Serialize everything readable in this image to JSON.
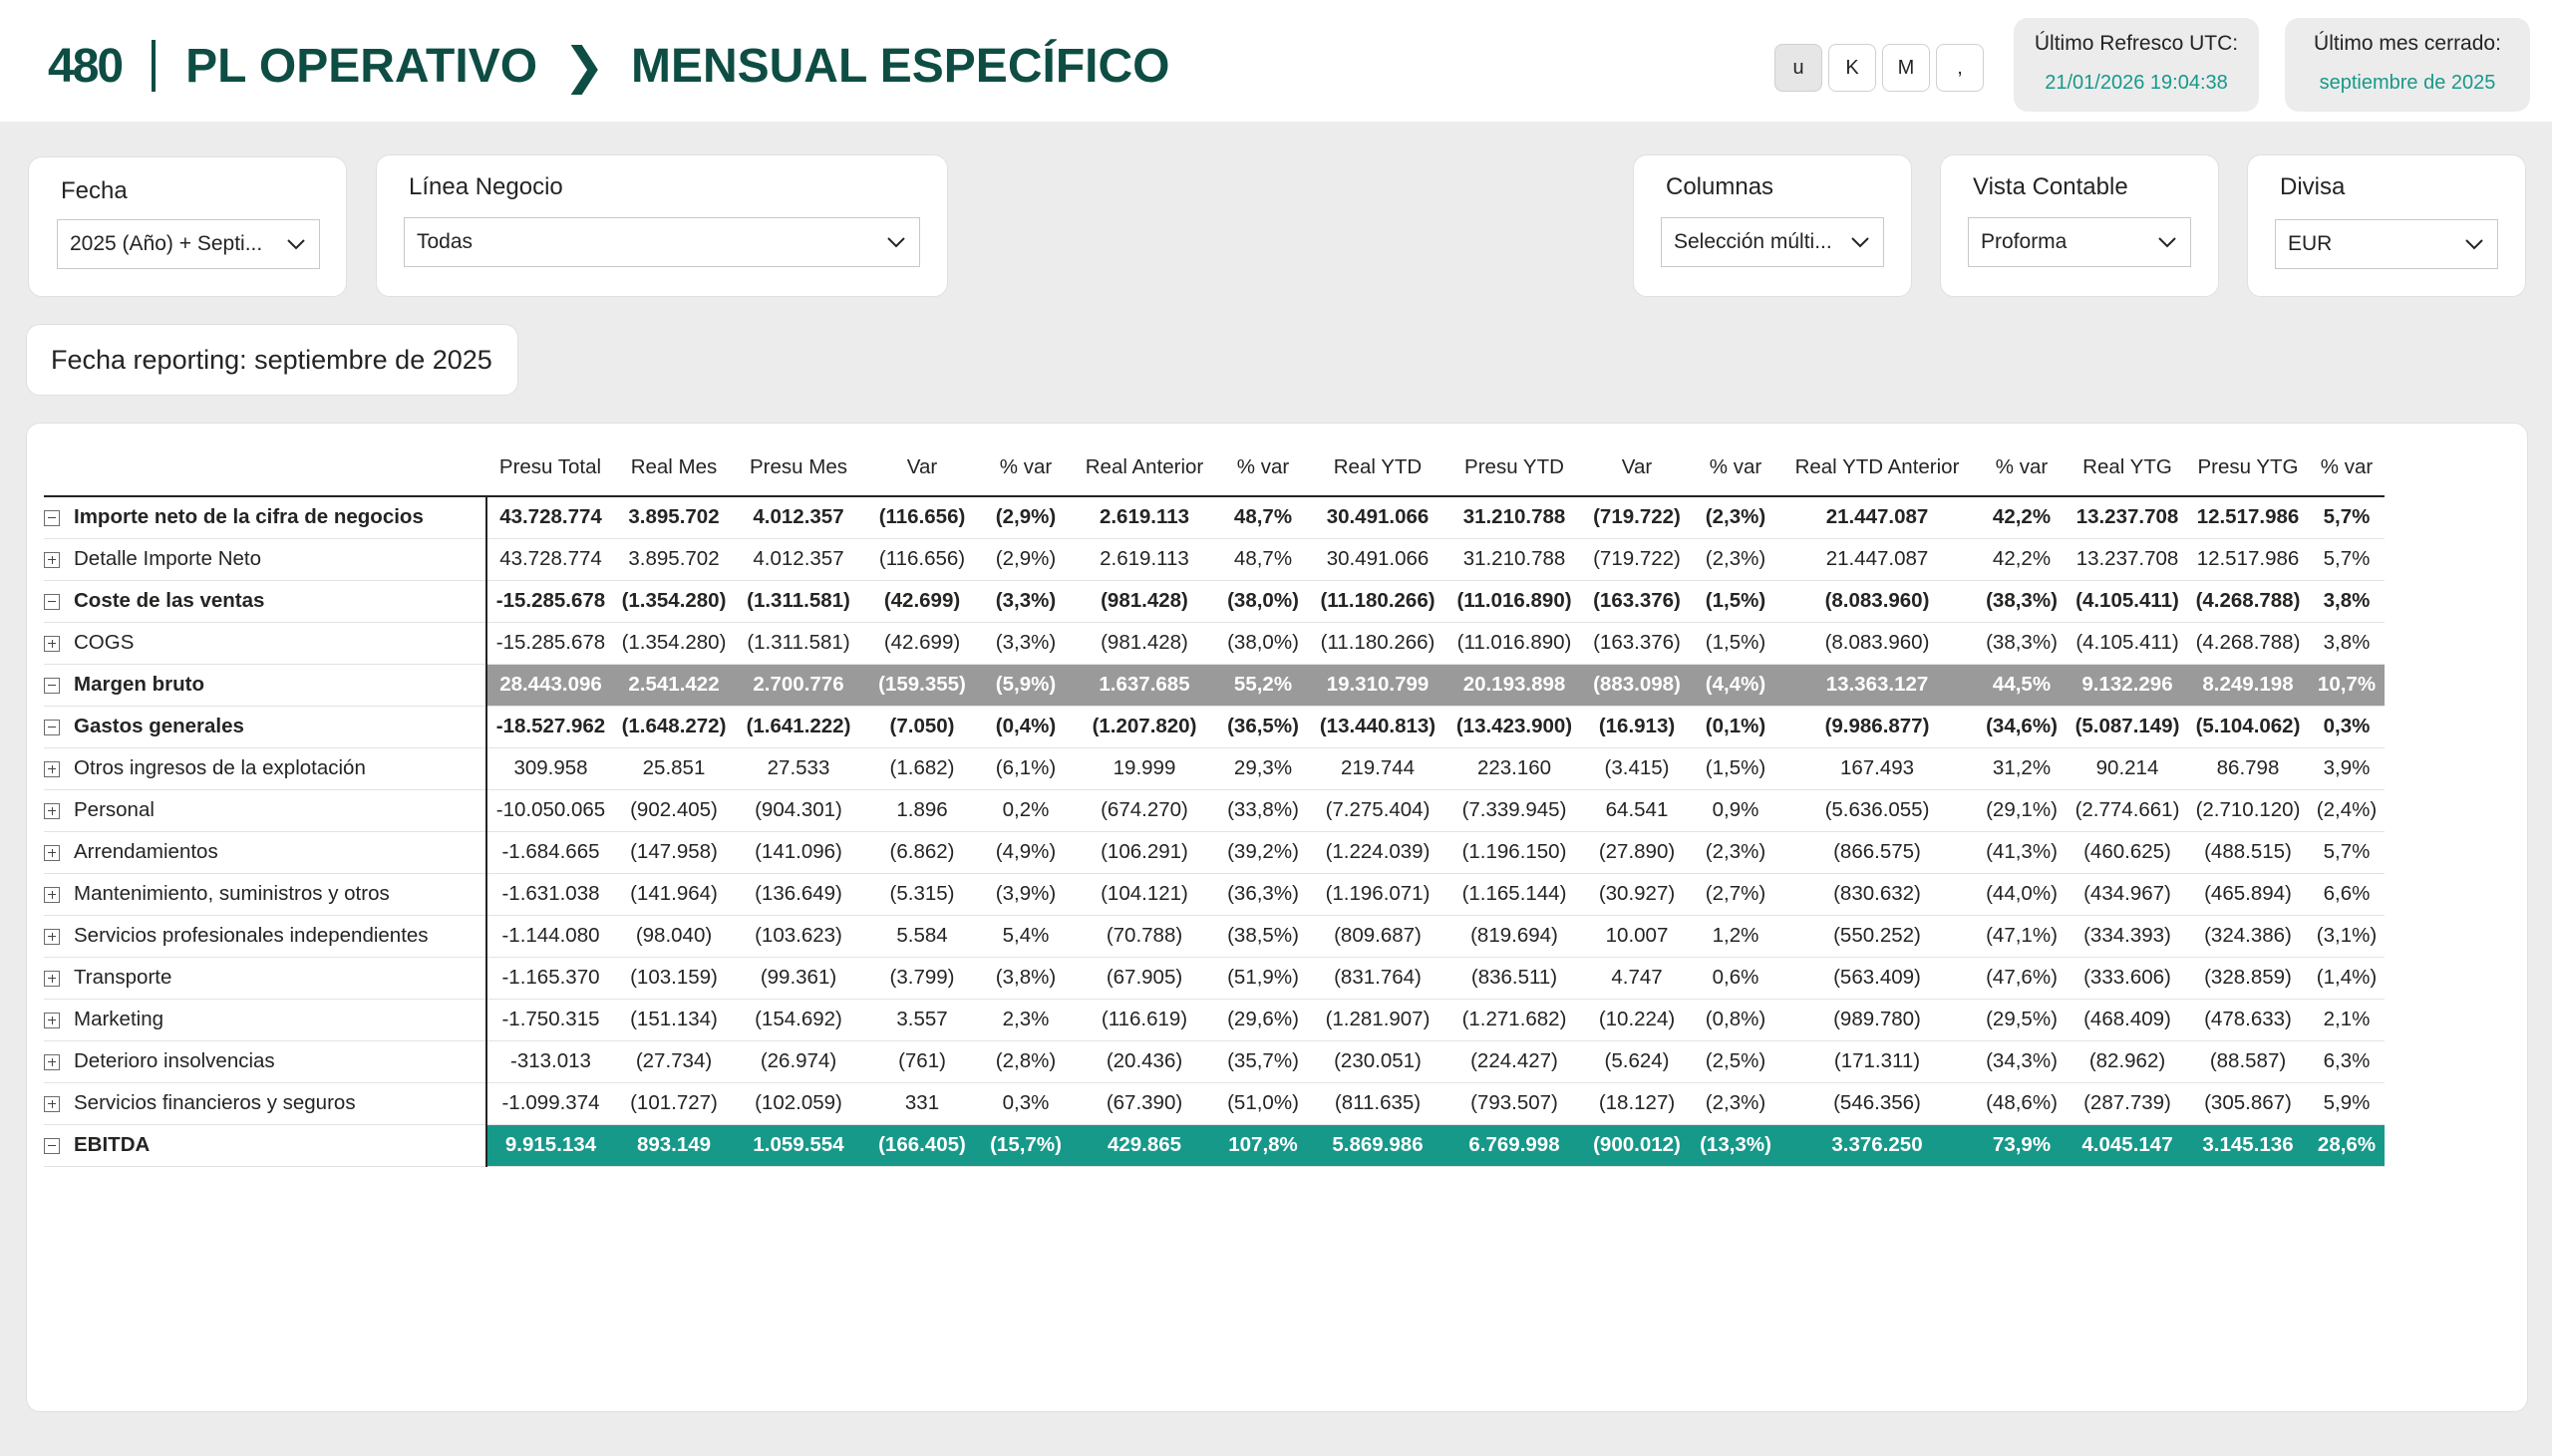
{
  "header": {
    "logo": "480",
    "title1": "PL OPERATIVO",
    "title2": "MENSUAL ESPECÍFICO",
    "unit_buttons": [
      "u",
      "K",
      "M",
      ","
    ],
    "refresh_label": "Último Refresco UTC:",
    "refresh_value": "21/01/2026 19:04:38",
    "closed_label": "Último mes cerrado:",
    "closed_value": "septiembre de 2025"
  },
  "filters": {
    "fecha": {
      "label": "Fecha",
      "value": "2025 (Año) + Septi..."
    },
    "linea": {
      "label": "Línea Negocio",
      "value": "Todas"
    },
    "columnas": {
      "label": "Columnas",
      "value": "Selección múlti..."
    },
    "vista": {
      "label": "Vista Contable",
      "value": "Proforma"
    },
    "divisa": {
      "label": "Divisa",
      "value": "EUR"
    }
  },
  "reporting": "Fecha reporting: septiembre de 2025",
  "colors": {
    "brand": "#0e4d43",
    "accent": "#17998a",
    "highlight_gray": "#9a9a9a"
  },
  "table": {
    "columns": [
      "Presu Total",
      "Real Mes",
      "Presu Mes",
      "Var",
      "% var",
      "Real Anterior",
      "% var",
      "Real YTD",
      "Presu YTD",
      "Var",
      "% var",
      "Real YTD Anterior",
      "% var",
      "Real YTG",
      "Presu YTG",
      "% var"
    ],
    "rows": [
      {
        "label": "Importe neto de la cifra de negocios",
        "level": 0,
        "toggle": "minus",
        "style": "bold",
        "values": [
          "43.728.774",
          "3.895.702",
          "4.012.357",
          "(116.656)",
          "(2,9%)",
          "2.619.113",
          "48,7%",
          "30.491.066",
          "31.210.788",
          "(719.722)",
          "(2,3%)",
          "21.447.087",
          "42,2%",
          "13.237.708",
          "12.517.986",
          "5,7%"
        ]
      },
      {
        "label": "Detalle Importe Neto",
        "level": 1,
        "toggle": "plus",
        "style": "",
        "values": [
          "43.728.774",
          "3.895.702",
          "4.012.357",
          "(116.656)",
          "(2,9%)",
          "2.619.113",
          "48,7%",
          "30.491.066",
          "31.210.788",
          "(719.722)",
          "(2,3%)",
          "21.447.087",
          "42,2%",
          "13.237.708",
          "12.517.986",
          "5,7%"
        ]
      },
      {
        "label": "Coste de las ventas",
        "level": 0,
        "toggle": "minus",
        "style": "bold",
        "values": [
          "-15.285.678",
          "(1.354.280)",
          "(1.311.581)",
          "(42.699)",
          "(3,3%)",
          "(981.428)",
          "(38,0%)",
          "(11.180.266)",
          "(11.016.890)",
          "(163.376)",
          "(1,5%)",
          "(8.083.960)",
          "(38,3%)",
          "(4.105.411)",
          "(4.268.788)",
          "3,8%"
        ]
      },
      {
        "label": "COGS",
        "level": 1,
        "toggle": "plus",
        "style": "",
        "values": [
          "-15.285.678",
          "(1.354.280)",
          "(1.311.581)",
          "(42.699)",
          "(3,3%)",
          "(981.428)",
          "(38,0%)",
          "(11.180.266)",
          "(11.016.890)",
          "(163.376)",
          "(1,5%)",
          "(8.083.960)",
          "(38,3%)",
          "(4.105.411)",
          "(4.268.788)",
          "3,8%"
        ]
      },
      {
        "label": "Margen bruto",
        "level": 0,
        "toggle": "minus",
        "style": "hl-gray",
        "values": [
          "28.443.096",
          "2.541.422",
          "2.700.776",
          "(159.355)",
          "(5,9%)",
          "1.637.685",
          "55,2%",
          "19.310.799",
          "20.193.898",
          "(883.098)",
          "(4,4%)",
          "13.363.127",
          "44,5%",
          "9.132.296",
          "8.249.198",
          "10,7%"
        ]
      },
      {
        "label": "Gastos generales",
        "level": 0,
        "toggle": "minus",
        "style": "bold",
        "values": [
          "-18.527.962",
          "(1.648.272)",
          "(1.641.222)",
          "(7.050)",
          "(0,4%)",
          "(1.207.820)",
          "(36,5%)",
          "(13.440.813)",
          "(13.423.900)",
          "(16.913)",
          "(0,1%)",
          "(9.986.877)",
          "(34,6%)",
          "(5.087.149)",
          "(5.104.062)",
          "0,3%"
        ]
      },
      {
        "label": "Otros ingresos de la explotación",
        "level": 1,
        "toggle": "plus",
        "style": "",
        "values": [
          "309.958",
          "25.851",
          "27.533",
          "(1.682)",
          "(6,1%)",
          "19.999",
          "29,3%",
          "219.744",
          "223.160",
          "(3.415)",
          "(1,5%)",
          "167.493",
          "31,2%",
          "90.214",
          "86.798",
          "3,9%"
        ]
      },
      {
        "label": "Personal",
        "level": 1,
        "toggle": "plus",
        "style": "",
        "values": [
          "-10.050.065",
          "(902.405)",
          "(904.301)",
          "1.896",
          "0,2%",
          "(674.270)",
          "(33,8%)",
          "(7.275.404)",
          "(7.339.945)",
          "64.541",
          "0,9%",
          "(5.636.055)",
          "(29,1%)",
          "(2.774.661)",
          "(2.710.120)",
          "(2,4%)"
        ]
      },
      {
        "label": "Arrendamientos",
        "level": 1,
        "toggle": "plus",
        "style": "",
        "values": [
          "-1.684.665",
          "(147.958)",
          "(141.096)",
          "(6.862)",
          "(4,9%)",
          "(106.291)",
          "(39,2%)",
          "(1.224.039)",
          "(1.196.150)",
          "(27.890)",
          "(2,3%)",
          "(866.575)",
          "(41,3%)",
          "(460.625)",
          "(488.515)",
          "5,7%"
        ]
      },
      {
        "label": "Mantenimiento, suministros y otros",
        "level": 1,
        "toggle": "plus",
        "style": "",
        "values": [
          "-1.631.038",
          "(141.964)",
          "(136.649)",
          "(5.315)",
          "(3,9%)",
          "(104.121)",
          "(36,3%)",
          "(1.196.071)",
          "(1.165.144)",
          "(30.927)",
          "(2,7%)",
          "(830.632)",
          "(44,0%)",
          "(434.967)",
          "(465.894)",
          "6,6%"
        ]
      },
      {
        "label": "Servicios profesionales independientes",
        "level": 1,
        "toggle": "plus",
        "style": "",
        "values": [
          "-1.144.080",
          "(98.040)",
          "(103.623)",
          "5.584",
          "5,4%",
          "(70.788)",
          "(38,5%)",
          "(809.687)",
          "(819.694)",
          "10.007",
          "1,2%",
          "(550.252)",
          "(47,1%)",
          "(334.393)",
          "(324.386)",
          "(3,1%)"
        ]
      },
      {
        "label": "Transporte",
        "level": 1,
        "toggle": "plus",
        "style": "",
        "values": [
          "-1.165.370",
          "(103.159)",
          "(99.361)",
          "(3.799)",
          "(3,8%)",
          "(67.905)",
          "(51,9%)",
          "(831.764)",
          "(836.511)",
          "4.747",
          "0,6%",
          "(563.409)",
          "(47,6%)",
          "(333.606)",
          "(328.859)",
          "(1,4%)"
        ]
      },
      {
        "label": "Marketing",
        "level": 1,
        "toggle": "plus",
        "style": "",
        "values": [
          "-1.750.315",
          "(151.134)",
          "(154.692)",
          "3.557",
          "2,3%",
          "(116.619)",
          "(29,6%)",
          "(1.281.907)",
          "(1.271.682)",
          "(10.224)",
          "(0,8%)",
          "(989.780)",
          "(29,5%)",
          "(468.409)",
          "(478.633)",
          "2,1%"
        ]
      },
      {
        "label": "Deterioro insolvencias",
        "level": 1,
        "toggle": "plus",
        "style": "",
        "values": [
          "-313.013",
          "(27.734)",
          "(26.974)",
          "(761)",
          "(2,8%)",
          "(20.436)",
          "(35,7%)",
          "(230.051)",
          "(224.427)",
          "(5.624)",
          "(2,5%)",
          "(171.311)",
          "(34,3%)",
          "(82.962)",
          "(88.587)",
          "6,3%"
        ]
      },
      {
        "label": "Servicios financieros y seguros",
        "level": 1,
        "toggle": "plus",
        "style": "",
        "values": [
          "-1.099.374",
          "(101.727)",
          "(102.059)",
          "331",
          "0,3%",
          "(67.390)",
          "(51,0%)",
          "(811.635)",
          "(793.507)",
          "(18.127)",
          "(2,3%)",
          "(546.356)",
          "(48,6%)",
          "(287.739)",
          "(305.867)",
          "5,9%"
        ]
      },
      {
        "label": "EBITDA",
        "level": 0,
        "toggle": "minus",
        "style": "hl-teal",
        "values": [
          "9.915.134",
          "893.149",
          "1.059.554",
          "(166.405)",
          "(15,7%)",
          "429.865",
          "107,8%",
          "5.869.986",
          "6.769.998",
          "(900.012)",
          "(13,3%)",
          "3.376.250",
          "73,9%",
          "4.045.147",
          "3.145.136",
          "28,6%"
        ]
      }
    ]
  }
}
